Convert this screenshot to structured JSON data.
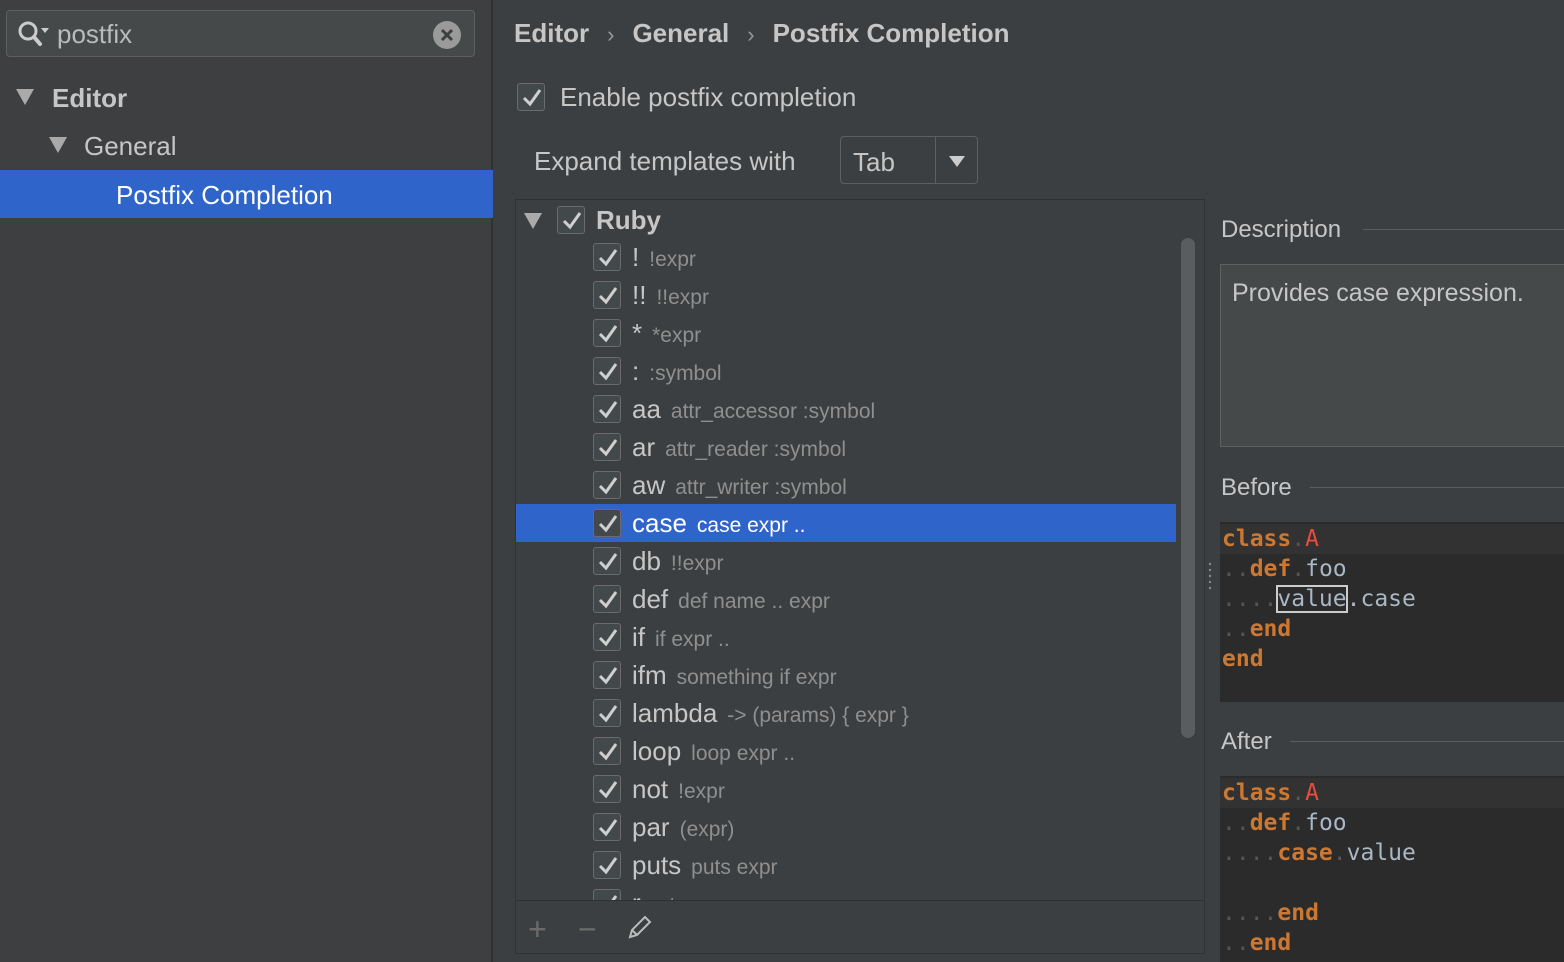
{
  "search": {
    "value": "postfix"
  },
  "tree": {
    "editor": "Editor",
    "general": "General",
    "postfix": "Postfix Completion"
  },
  "breadcrumb": [
    "Editor",
    "General",
    "Postfix Completion"
  ],
  "enable_label": "Enable postfix completion",
  "expand": {
    "label": "Expand templates with",
    "value": "Tab"
  },
  "group": "Ruby",
  "templates": [
    {
      "key": "!",
      "desc": "!expr"
    },
    {
      "key": "!!",
      "desc": "!!expr"
    },
    {
      "key": "*",
      "desc": "*expr"
    },
    {
      "key": ":",
      "desc": ":symbol"
    },
    {
      "key": "aa",
      "desc": "attr_accessor :symbol"
    },
    {
      "key": "ar",
      "desc": "attr_reader :symbol"
    },
    {
      "key": "aw",
      "desc": "attr_writer :symbol"
    },
    {
      "key": "case",
      "desc": "case expr .."
    },
    {
      "key": "db",
      "desc": "!!expr"
    },
    {
      "key": "def",
      "desc": "def name .. expr"
    },
    {
      "key": "if",
      "desc": "if expr .."
    },
    {
      "key": "ifm",
      "desc": "something if expr"
    },
    {
      "key": "lambda",
      "desc": "-> (params) { expr }"
    },
    {
      "key": "loop",
      "desc": "loop expr .."
    },
    {
      "key": "not",
      "desc": "!expr"
    },
    {
      "key": "par",
      "desc": "(expr)"
    },
    {
      "key": "puts",
      "desc": "puts expr"
    },
    {
      "key": "r",
      "desc": "return expr"
    }
  ],
  "selected_index": 7,
  "description": {
    "title": "Description",
    "text": "Provides case expression."
  },
  "before": {
    "title": "Before"
  },
  "after": {
    "title": "After"
  },
  "code": {
    "kw_class": "class",
    "class_name": "A",
    "kw_def": "def",
    "method_name": "foo",
    "value": "value",
    "dot_case": ".case",
    "kw_case": "case",
    "kw_end": "end"
  },
  "colors": {
    "selection": "#2f65ca",
    "keyword": "#cc7832",
    "class_name": "#e74c3c"
  },
  "icons": [
    "search-icon",
    "clear-icon",
    "add-icon",
    "remove-icon",
    "edit-icon",
    "check-icon"
  ]
}
